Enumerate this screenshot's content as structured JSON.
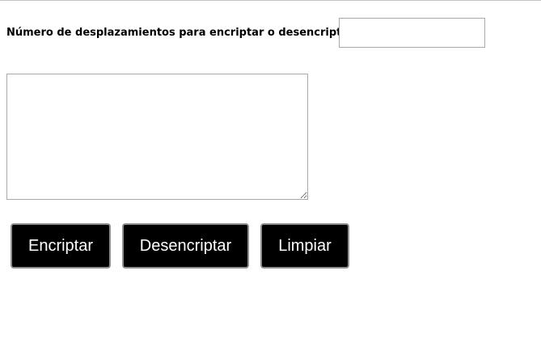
{
  "form": {
    "shift_label": "Número de desplazamientos para encriptar o desencriptar",
    "shift_value": "",
    "message_value": ""
  },
  "buttons": {
    "encrypt_label": "Encriptar",
    "decrypt_label": "Desencriptar",
    "clear_label": "Limpiar"
  },
  "colors": {
    "button_background": "#000000",
    "button_text": "#ffffff",
    "button_border": "#8f8f8f"
  }
}
